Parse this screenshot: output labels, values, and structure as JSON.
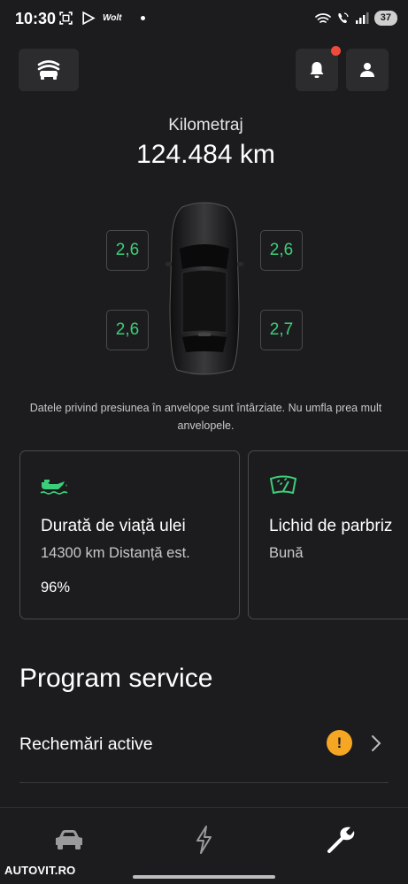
{
  "status_bar": {
    "time": "10:30",
    "app_label": "Wolt",
    "battery": "37"
  },
  "header": {
    "garage_icon": "garage-icon",
    "bell_icon": "bell-icon",
    "profile_icon": "profile-icon",
    "notification_color": "#ef4b3a"
  },
  "mileage": {
    "label": "Kilometraj",
    "value": "124.484 km"
  },
  "tires": {
    "front_left": "2,6",
    "front_right": "2,6",
    "rear_left": "2,6",
    "rear_right": "2,7",
    "value_color": "#3ccf7a",
    "note": "Datele privind presiunea în anvelope sunt întârziate. Nu umfla prea mult anvelopele."
  },
  "cards": [
    {
      "icon": "oil-can-icon",
      "title": "Durată de viață ulei",
      "subtitle": "14300 km Distanță est.",
      "percent": "96%"
    },
    {
      "icon": "windshield-washer-icon",
      "title": "Lichid de parbriz",
      "subtitle": "Bună"
    }
  ],
  "service": {
    "section_title": "Program service",
    "recall_label": "Rechemări active",
    "warning_symbol": "!",
    "warning_color": "#f5a623"
  },
  "bottom_nav": {
    "items": [
      "car-icon",
      "charge-icon",
      "wrench-icon"
    ]
  },
  "watermark": "AUTOVIT.RO"
}
